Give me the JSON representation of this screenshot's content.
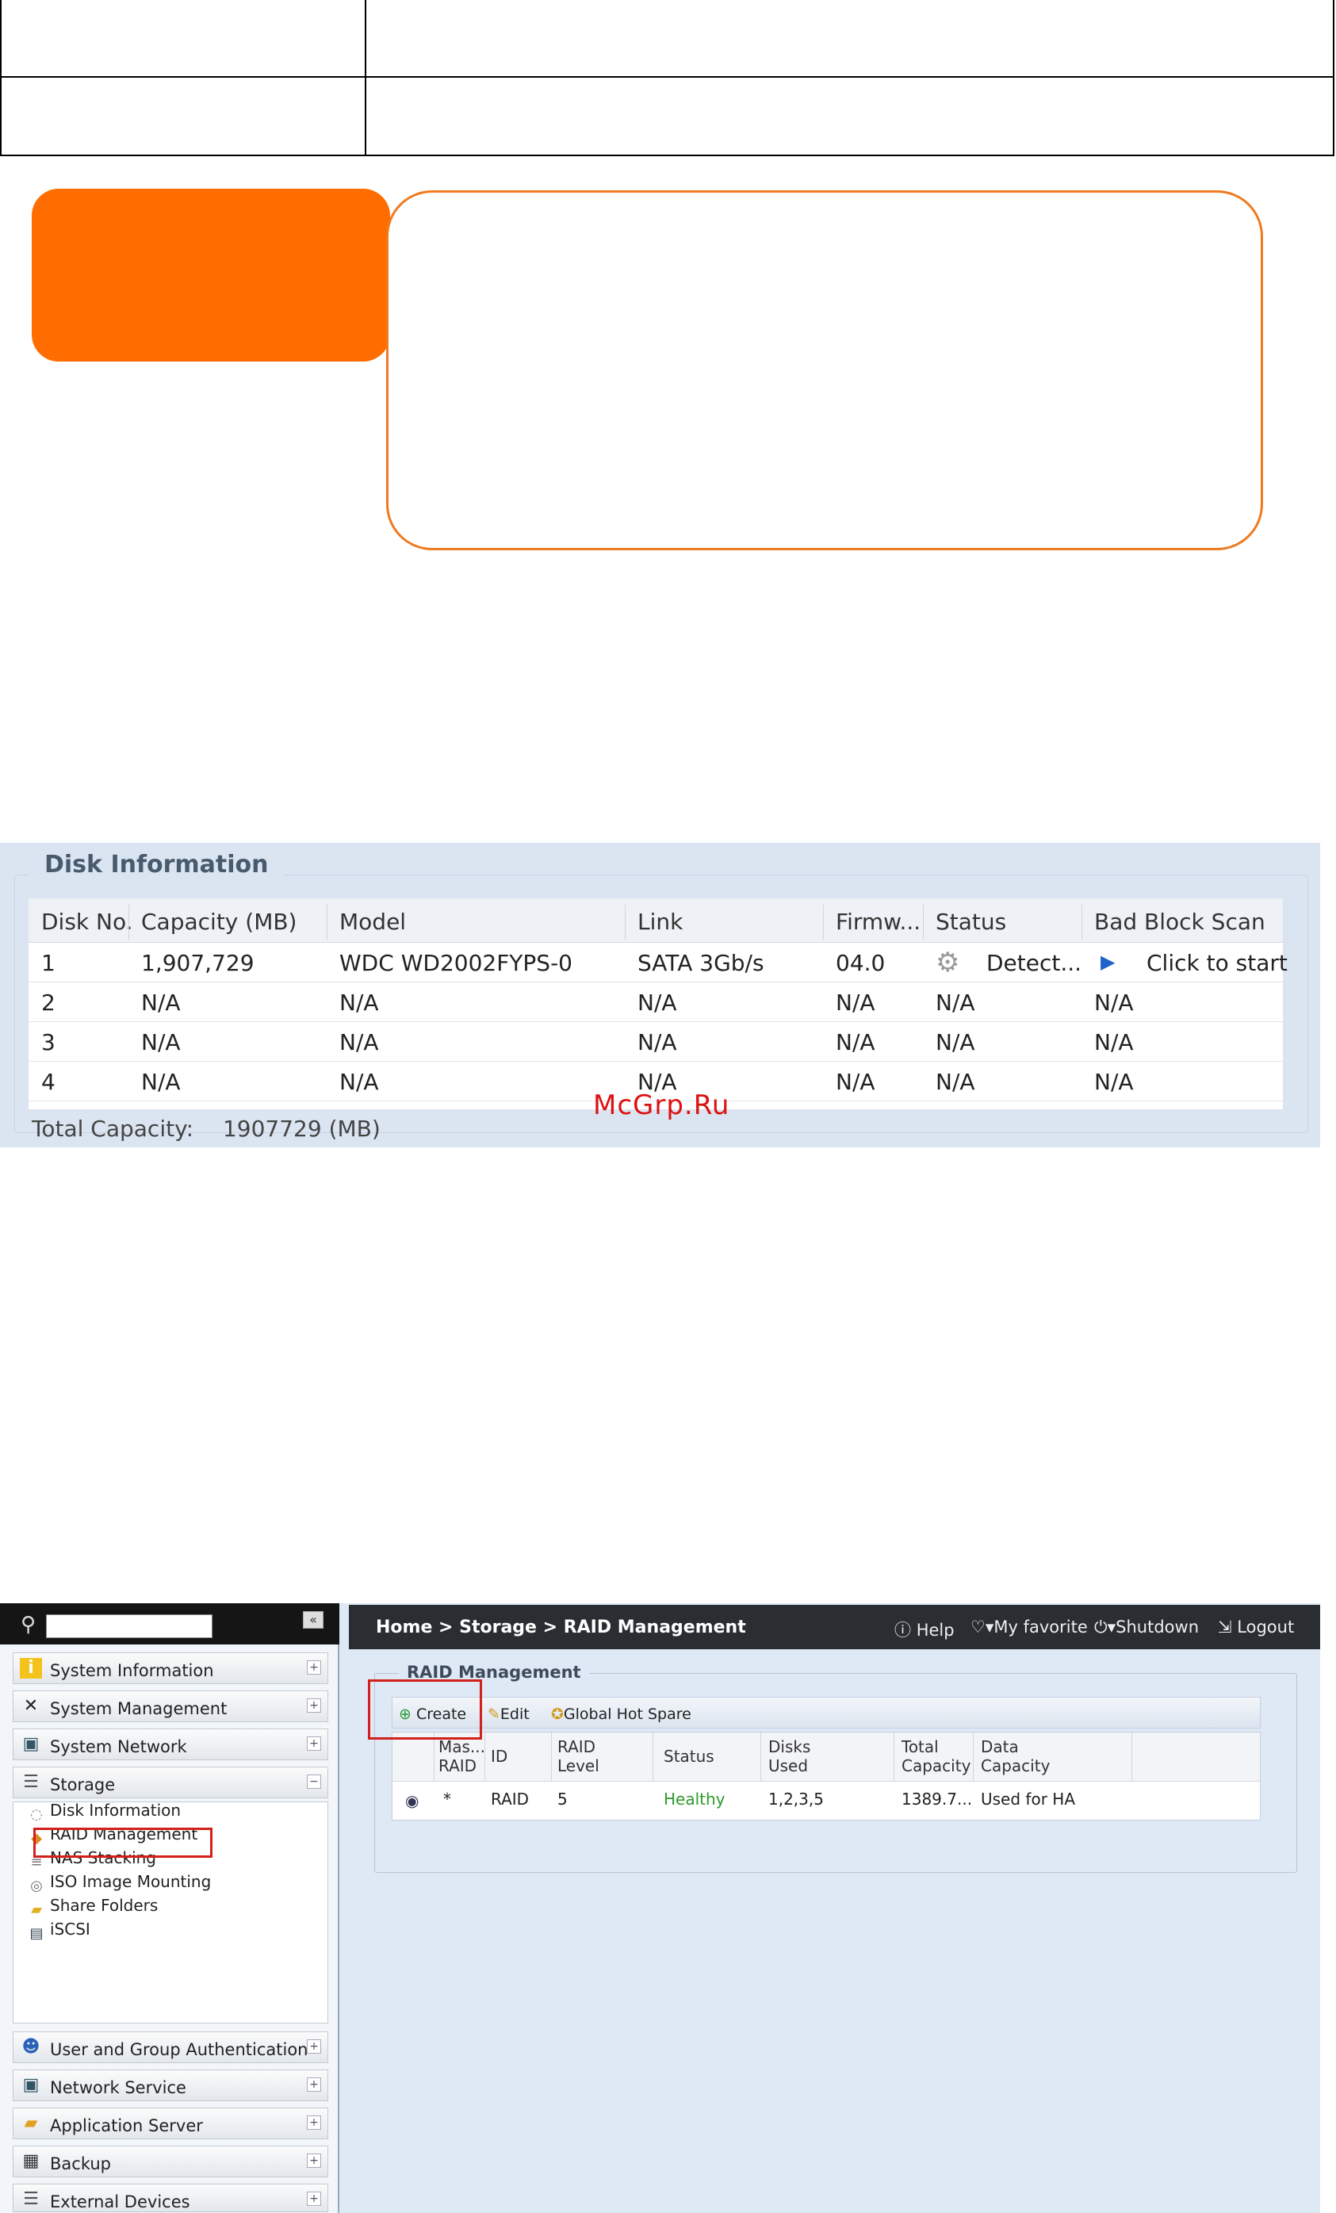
{
  "disk_info": {
    "title": "Disk Information",
    "columns": [
      "Disk No.",
      "Capacity (MB)",
      "Model",
      "Link",
      "Firmw...",
      "Status",
      "Bad Block Scan"
    ],
    "rows": [
      {
        "no": "1",
        "capacity": "1,907,729",
        "model": "WDC WD2002FYPS-0",
        "link": "SATA 3Gb/s",
        "firmware": "04.0",
        "status": "Detect...",
        "scan": "Click to start"
      },
      {
        "no": "2",
        "capacity": "N/A",
        "model": "N/A",
        "link": "N/A",
        "firmware": "N/A",
        "status": "N/A",
        "scan": "N/A"
      },
      {
        "no": "3",
        "capacity": "N/A",
        "model": "N/A",
        "link": "N/A",
        "firmware": "N/A",
        "status": "N/A",
        "scan": "N/A"
      },
      {
        "no": "4",
        "capacity": "N/A",
        "model": "N/A",
        "link": "N/A",
        "firmware": "N/A",
        "status": "N/A",
        "scan": "N/A"
      }
    ],
    "total_label": "Total Capacity:",
    "total_value": "1907729 (MB)"
  },
  "watermark": "McGrp.Ru",
  "nas": {
    "breadcrumb": "Home > Storage > RAID Management",
    "header_actions": {
      "help": "Help",
      "favorite": "My favorite",
      "shutdown": "Shutdown",
      "logout": "Logout"
    },
    "menu": {
      "top": [
        {
          "label": "System Information",
          "icon": "info-icon"
        },
        {
          "label": "System Management",
          "icon": "tools-icon"
        },
        {
          "label": "System Network",
          "icon": "network-icon"
        },
        {
          "label": "Storage",
          "icon": "storage-icon"
        }
      ],
      "storage_sub": [
        "Disk Information",
        "RAID Management",
        "NAS Stacking",
        "ISO Image Mounting",
        "Share Folders",
        "iSCSI"
      ],
      "bottom": [
        {
          "label": "User and Group Authentication",
          "icon": "users-icon"
        },
        {
          "label": "Network Service",
          "icon": "network-service-icon"
        },
        {
          "label": "Application Server",
          "icon": "app-server-icon"
        },
        {
          "label": "Backup",
          "icon": "backup-icon"
        },
        {
          "label": "External Devices",
          "icon": "external-devices-icon"
        }
      ]
    },
    "raid": {
      "title": "RAID Management",
      "toolbar": {
        "create": "Create",
        "edit": "Edit",
        "hot_spare": "Global Hot Spare"
      },
      "columns": {
        "master": "Mas... RAID",
        "id": "ID",
        "level": "RAID Level",
        "status": "Status",
        "disks": "Disks Used",
        "total": "Total Capacity",
        "data": "Data Capacity"
      },
      "row": {
        "master": "*",
        "id": "RAID",
        "level": "5",
        "status": "Healthy",
        "disks": "1,2,3,5",
        "total": "1389.7...",
        "data": "Used for HA"
      }
    }
  }
}
